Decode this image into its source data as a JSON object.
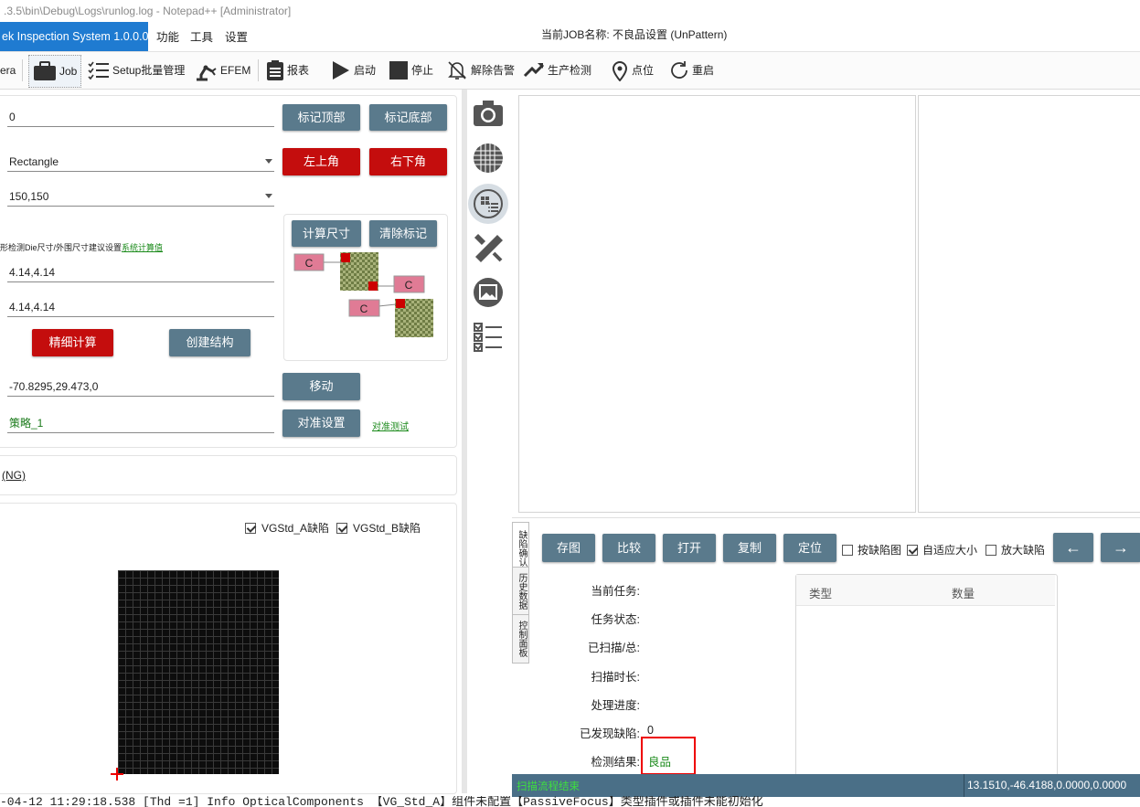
{
  "window": {
    "title": ".3.5\\bin\\Debug\\Logs\\runlog.log - Notepad++ [Administrator]"
  },
  "menubar": {
    "app_title": "ek Inspection System 1.0.0.0",
    "items": [
      "功能",
      "工具",
      "设置"
    ],
    "job_name": "当前JOB名称: 不良品设置 (UnPattern)"
  },
  "toolbar": {
    "items": [
      {
        "label": "era",
        "icon": "camera-icon"
      },
      {
        "label": "Job",
        "icon": "briefcase-icon"
      },
      {
        "label": "Setup批量管理",
        "icon": "checklist-icon"
      },
      {
        "label": "EFEM",
        "icon": "robot-arm-icon"
      },
      {
        "label": "报表",
        "icon": "report-icon"
      },
      {
        "label": "启动",
        "icon": "play-icon"
      },
      {
        "label": "停止",
        "icon": "stop-icon"
      },
      {
        "label": "解除告警",
        "icon": "bell-off-icon"
      },
      {
        "label": "生产检测",
        "icon": "production-icon"
      },
      {
        "label": "点位",
        "icon": "map-pin-icon"
      },
      {
        "label": "重启",
        "icon": "restart-icon"
      }
    ]
  },
  "left": {
    "field_offset": "0",
    "btn_mark_top": "标记顶部",
    "btn_mark_bottom": "标记底部",
    "shape_select": "Rectangle",
    "btn_top_left": "左上角",
    "btn_bottom_right": "右下角",
    "size_select": "150,150",
    "hint_text": "形检测Die尺寸/外围尺寸建议设置",
    "hint_link": "系统计算值",
    "field_die_size": "4.14,4.14",
    "field_outer_size": "4.14,4.14",
    "btn_calc_size": "计算尺寸",
    "btn_clear_mark": "清除标记",
    "diagram_label": "C",
    "btn_fine_calc": "精细计算",
    "btn_create_struct": "创建结构",
    "field_position": "-70.8295,29.473,0",
    "btn_move": "移动",
    "field_strategy": "策略_1",
    "btn_align_setting": "对准设置",
    "link_align_test": "对准测试",
    "ng_label": "(NG)",
    "chk_a": "VGStd_A缺陷",
    "chk_b": "VGStd_B缺陷"
  },
  "right": {
    "vtabs": [
      "缺陷确认",
      "历史数据",
      "控制面板"
    ],
    "buttons": [
      "存图",
      "比较",
      "打开",
      "复制",
      "定位"
    ],
    "chk_defect_map": "按缺陷图",
    "chk_auto_fit": "自适应大小",
    "chk_zoom_defect": "放大缺陷",
    "info_labels": [
      "当前任务:",
      "任务状态:",
      "已扫描/总:",
      "扫描时长:",
      "处理进度:",
      "已发现缺陷:",
      "检测结果:"
    ],
    "defects_found": "0",
    "result_value": "良品",
    "result_color": "#1a8a1a",
    "table_headers": [
      "类型",
      "数量"
    ]
  },
  "status": {
    "left": "扫描流程结束",
    "right": "13.1510,-46.4188,0.0000,0.0000"
  },
  "log_line": "-04-12 11:29:18.538 [Thd =1]  Info OpticalComponents 【VG_Std_A】组件未配置【PassiveFocus】类型插件或插件未能初始化"
}
